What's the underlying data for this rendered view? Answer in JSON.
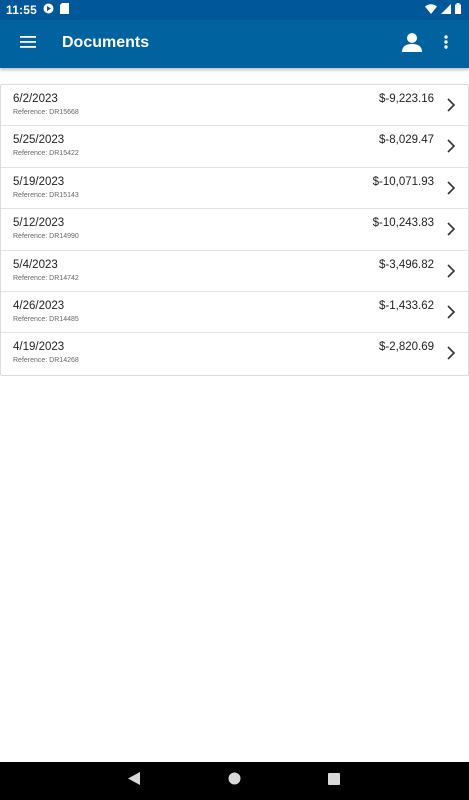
{
  "status_bar": {
    "time": "11:55",
    "icons": [
      "app-notification-icon",
      "sim-card-icon",
      "wifi-icon",
      "signal-icon",
      "battery-icon"
    ]
  },
  "app_bar": {
    "title": "Documents",
    "background": "#00629f",
    "icons": [
      "menu-icon",
      "account-icon",
      "more-vert-icon"
    ]
  },
  "documents": [
    {
      "date": "6/2/2023",
      "reference": "Reference: DR15668",
      "amount": "$-9,223.16"
    },
    {
      "date": "5/25/2023",
      "reference": "Reference: DR15422",
      "amount": "$-8,029.47"
    },
    {
      "date": "5/19/2023",
      "reference": "Reference: DR15143",
      "amount": "$-10,071.93"
    },
    {
      "date": "5/12/2023",
      "reference": "Reference: DR14990",
      "amount": "$-10,243.83"
    },
    {
      "date": "5/4/2023",
      "reference": "Reference: DR14742",
      "amount": "$-3,496.82"
    },
    {
      "date": "4/26/2023",
      "reference": "Reference: DR14485",
      "amount": "$-1,433.62"
    },
    {
      "date": "4/19/2023",
      "reference": "Reference: DR14268",
      "amount": "$-2,820.69"
    }
  ],
  "nav_bar": {
    "icons": [
      "back-icon",
      "home-icon",
      "recents-icon"
    ]
  }
}
